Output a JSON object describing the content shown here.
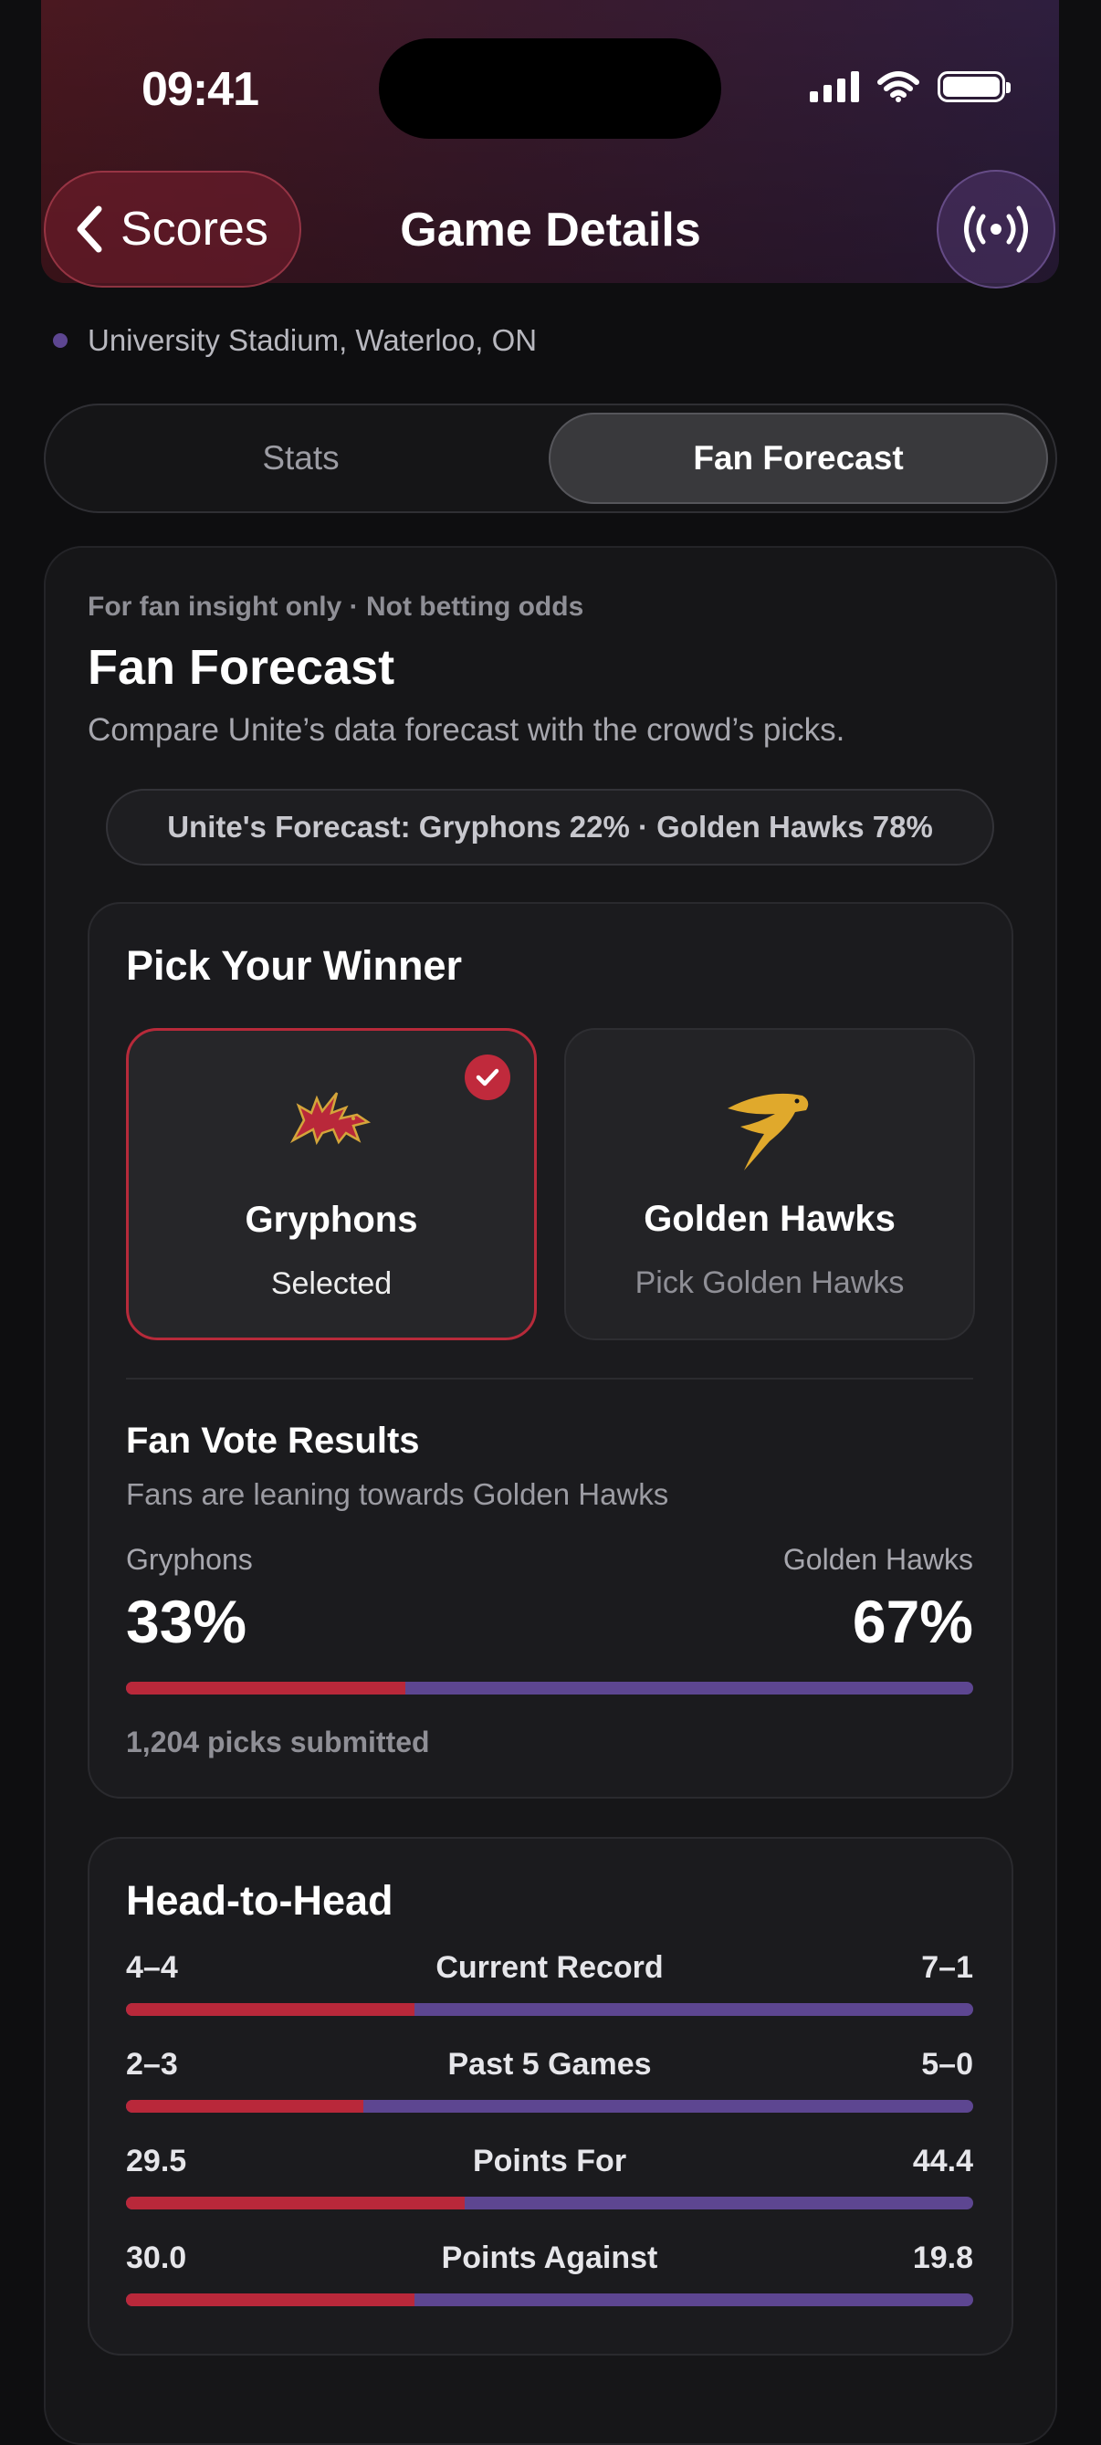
{
  "status": {
    "time": "09:41"
  },
  "nav": {
    "back_label": "Scores",
    "title": "Game Details"
  },
  "venue": "University Stadium, Waterloo, ON",
  "tabs": [
    {
      "label": "Stats",
      "active": false
    },
    {
      "label": "Fan Forecast",
      "active": true
    }
  ],
  "forecast": {
    "disclaimer": "For fan insight only · Not betting odds",
    "title": "Fan Forecast",
    "subtitle": "Compare Unite’s data forecast with the crowd’s picks.",
    "unite_pill": "Unite's Forecast: Gryphons 22% · Golden Hawks 78%"
  },
  "pick": {
    "title": "Pick Your Winner",
    "teams": [
      {
        "name": "Gryphons",
        "status": "Selected",
        "selected": true
      },
      {
        "name": "Golden Hawks",
        "status": "Pick Golden Hawks",
        "selected": false
      }
    ]
  },
  "fan_vote": {
    "title": "Fan Vote Results",
    "subtitle": "Fans are leaning towards Golden Hawks",
    "left_team": "Gryphons",
    "right_team": "Golden Hawks",
    "left_pct": "33%",
    "right_pct": "67%",
    "left_fraction": 0.33,
    "count_text": "1,204 picks submitted"
  },
  "head_to_head": {
    "title": "Head-to-Head",
    "rows": [
      {
        "left": "4–4",
        "category": "Current Record",
        "right": "7–1",
        "left_fraction": 0.34
      },
      {
        "left": "2–3",
        "category": "Past 5 Games",
        "right": "5–0",
        "left_fraction": 0.28
      },
      {
        "left": "29.5",
        "category": "Points For",
        "right": "44.4",
        "left_fraction": 0.4
      },
      {
        "left": "30.0",
        "category": "Points Against",
        "right": "19.8",
        "left_fraction": 0.34
      }
    ]
  },
  "colors": {
    "gryphons": "#b9283a",
    "golden_hawks": "#5d4691",
    "accent_check": "#c02a3c"
  },
  "icons": {
    "back": "chevron-left-icon",
    "live": "broadcast-icon",
    "check": "checkmark-icon"
  }
}
